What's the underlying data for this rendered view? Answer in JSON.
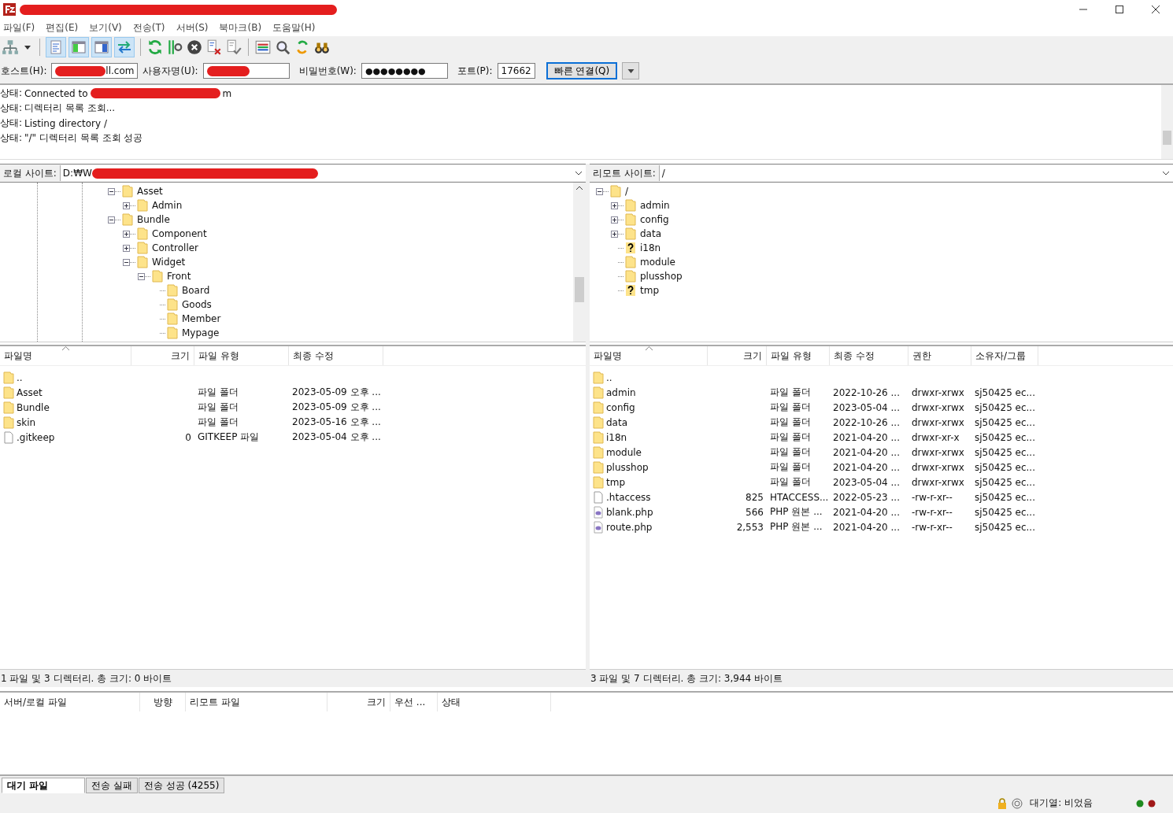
{
  "menu": [
    "파일(F)",
    "편집(E)",
    "보기(V)",
    "전송(T)",
    "서버(S)",
    "북마크(B)",
    "도움말(H)"
  ],
  "toolbar": {
    "toggles": [
      {
        "pressed": true
      },
      {
        "pressed": true
      },
      {
        "pressed": true
      },
      {
        "pressed": true
      }
    ]
  },
  "quickconnect": {
    "host_label": "호스트(H):",
    "host_value": "ll.com",
    "user_label": "사용자명(U):",
    "password_label": "비밀번호(W):",
    "password_value": "●●●●●●●●",
    "port_label": "포트(P):",
    "port_value": "17662",
    "connect_button": "빠른 연결(Q)"
  },
  "log": [
    {
      "label": "상태:",
      "parts": [
        "Connected to",
        "m"
      ]
    },
    {
      "label": "상태:",
      "parts": [
        "디렉터리 목록 조회..."
      ]
    },
    {
      "label": "상태:",
      "parts": [
        "Listing directory /"
      ]
    },
    {
      "label": "상태:",
      "parts": [
        "\"/\" 디렉터리 목록 조회 성공"
      ]
    }
  ],
  "local_site": {
    "label": "로컬 사이트:",
    "path": "D:₩W"
  },
  "remote_site": {
    "label": "리모트 사이트:",
    "path": "/"
  },
  "local_tree": [
    {
      "name": "Asset",
      "kind": "folder",
      "expanded": true,
      "children": [
        {
          "name": "Admin",
          "kind": "folder",
          "expanded": false
        }
      ]
    },
    {
      "name": "Bundle",
      "kind": "folder",
      "expanded": true,
      "children": [
        {
          "name": "Component",
          "kind": "folder",
          "expanded": false
        },
        {
          "name": "Controller",
          "kind": "folder",
          "expanded": false
        },
        {
          "name": "Widget",
          "kind": "folder",
          "expanded": true,
          "children": [
            {
              "name": "Front",
              "kind": "folder",
              "expanded": true,
              "children": [
                {
                  "name": "Board",
                  "kind": "folder"
                },
                {
                  "name": "Goods",
                  "kind": "folder"
                },
                {
                  "name": "Member",
                  "kind": "folder"
                },
                {
                  "name": "Mypage",
                  "kind": "folder"
                }
              ]
            }
          ]
        }
      ]
    }
  ],
  "remote_tree": [
    {
      "name": "/",
      "kind": "folder",
      "expanded": true,
      "children": [
        {
          "name": "admin",
          "kind": "folder",
          "expanded": false
        },
        {
          "name": "config",
          "kind": "folder",
          "expanded": false
        },
        {
          "name": "data",
          "kind": "folder",
          "expanded": false
        },
        {
          "name": "i18n",
          "kind": "unknown"
        },
        {
          "name": "module",
          "kind": "folder"
        },
        {
          "name": "plusshop",
          "kind": "folder"
        },
        {
          "name": "tmp",
          "kind": "unknown"
        }
      ]
    }
  ],
  "local_files": {
    "columns": [
      {
        "label": "파일명",
        "sorted": true
      },
      {
        "label": "크기",
        "sorted": false
      },
      {
        "label": "파일 유형",
        "sorted": false
      },
      {
        "label": "최종 수정",
        "sorted": false
      }
    ],
    "rows": [
      {
        "kind": "folder",
        "cells": [
          ".."
        ]
      },
      {
        "kind": "folder",
        "cells": [
          "Asset",
          "",
          "파일 폴더",
          "2023-05-09 오후 ..."
        ]
      },
      {
        "kind": "folder",
        "cells": [
          "Bundle",
          "",
          "파일 폴더",
          "2023-05-09 오후 ..."
        ]
      },
      {
        "kind": "folder",
        "cells": [
          "skin",
          "",
          "파일 폴더",
          "2023-05-16 오후 ..."
        ]
      },
      {
        "kind": "file",
        "cells": [
          ".gitkeep",
          "0",
          "GITKEEP 파일",
          "2023-05-04 오후 ..."
        ]
      }
    ],
    "summary": "1 파일 및 3 디렉터리. 총 크기: 0 바이트"
  },
  "remote_files": {
    "columns": [
      {
        "label": "파일명",
        "sorted": true
      },
      {
        "label": "크기",
        "sorted": false
      },
      {
        "label": "파일 유형",
        "sorted": false
      },
      {
        "label": "최종 수정",
        "sorted": false
      },
      {
        "label": "권한",
        "sorted": false
      },
      {
        "label": "소유자/그룹",
        "sorted": false
      }
    ],
    "rows": [
      {
        "kind": "folder",
        "cells": [
          ".."
        ]
      },
      {
        "kind": "folder",
        "cells": [
          "admin",
          "",
          "파일 폴더",
          "2022-10-26 ...",
          "drwxr-xrwx",
          "sj50425 ec..."
        ]
      },
      {
        "kind": "folder",
        "cells": [
          "config",
          "",
          "파일 폴더",
          "2023-05-04 ...",
          "drwxr-xrwx",
          "sj50425 ec..."
        ]
      },
      {
        "kind": "folder",
        "cells": [
          "data",
          "",
          "파일 폴더",
          "2022-10-26 ...",
          "drwxr-xrwx",
          "sj50425 ec..."
        ]
      },
      {
        "kind": "folder",
        "cells": [
          "i18n",
          "",
          "파일 폴더",
          "2021-04-20 ...",
          "drwxr-xr-x",
          "sj50425 ec..."
        ]
      },
      {
        "kind": "folder",
        "cells": [
          "module",
          "",
          "파일 폴더",
          "2021-04-20 ...",
          "drwxr-xrwx",
          "sj50425 ec..."
        ]
      },
      {
        "kind": "folder",
        "cells": [
          "plusshop",
          "",
          "파일 폴더",
          "2021-04-20 ...",
          "drwxr-xrwx",
          "sj50425 ec..."
        ]
      },
      {
        "kind": "folder",
        "cells": [
          "tmp",
          "",
          "파일 폴더",
          "2023-05-04 ...",
          "drwxr-xrwx",
          "sj50425 ec..."
        ]
      },
      {
        "kind": "file",
        "cells": [
          ".htaccess",
          "825",
          "HTACCESS...",
          "2022-05-23 ...",
          "-rw-r-xr--",
          "sj50425 ec..."
        ]
      },
      {
        "kind": "php",
        "cells": [
          "blank.php",
          "566",
          "PHP 원본 ...",
          "2021-04-20 ...",
          "-rw-r-xr--",
          "sj50425 ec..."
        ]
      },
      {
        "kind": "php",
        "cells": [
          "route.php",
          "2,553",
          "PHP 원본 ...",
          "2021-04-20 ...",
          "-rw-r-xr--",
          "sj50425 ec..."
        ]
      }
    ],
    "summary": "3 파일 및 7 디렉터리. 총 크기: 3,944 바이트"
  },
  "queue": {
    "columns": [
      "서버/로컬 파일",
      "방향",
      "리모트 파일",
      "크기",
      "우선 ...",
      "상태"
    ],
    "tabs": [
      {
        "label": "대기 파일",
        "selected": true
      },
      {
        "label": "전송 실패",
        "selected": false
      },
      {
        "label": "전송 성공 (4255)",
        "selected": false
      }
    ]
  },
  "status_bar": {
    "queue": "대기열: 비었음"
  }
}
